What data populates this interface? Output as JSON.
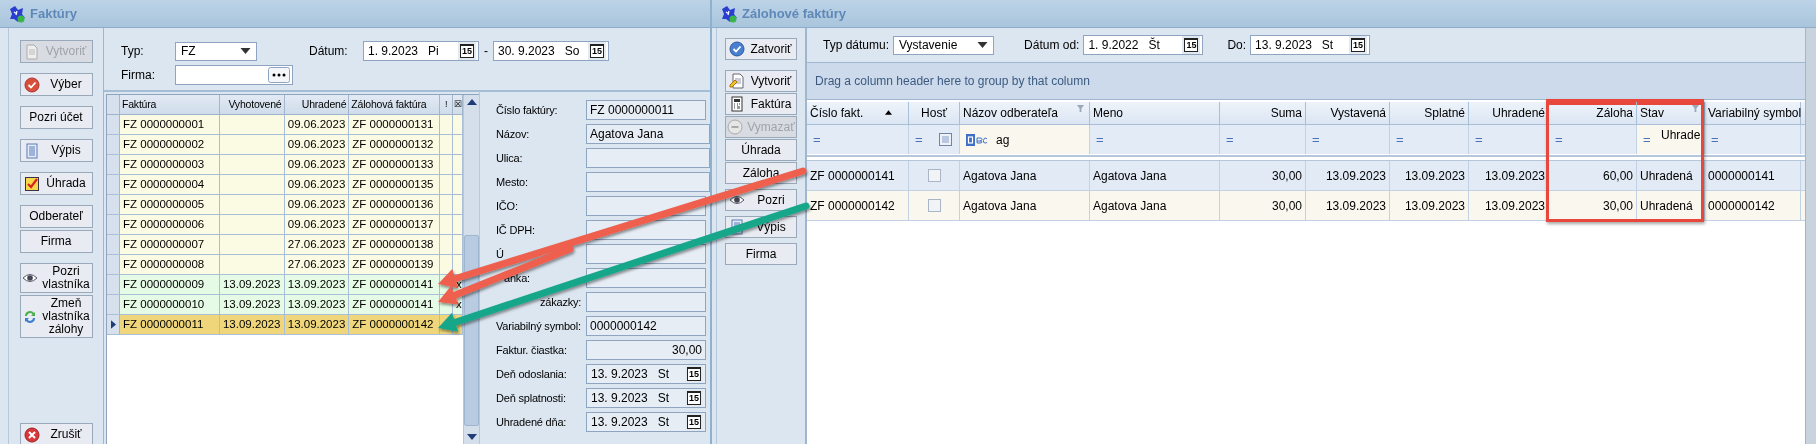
{
  "left_window": {
    "title": "Faktúry",
    "toolbar": [
      {
        "label": "Vytvoriť",
        "disabled": true
      },
      {
        "label": "Výber",
        "disabled": false
      },
      {
        "label": "Pozri účet",
        "disabled": false
      },
      {
        "label": "Výpis",
        "disabled": false
      },
      {
        "label": "Úhrada",
        "disabled": false
      },
      {
        "label": "Odberateľ",
        "disabled": false
      },
      {
        "label": "Firma",
        "disabled": false
      },
      {
        "label": "Pozri vlastníka",
        "disabled": false
      },
      {
        "label": "Zmeň vlastníka zálohy",
        "disabled": false
      },
      {
        "label": "Zrušiť",
        "disabled": false
      }
    ],
    "filters": {
      "type_label": "Typ:",
      "type_value": "FZ",
      "date_label": "Dátum:",
      "date_from": {
        "value": "1. 9.2023   Pi",
        "button": "15"
      },
      "date_separator": "-",
      "date_to": {
        "value": "30. 9.2023   So",
        "button": "15"
      },
      "firma_label": "Firma:"
    },
    "grid": {
      "columns": [
        "Faktúra",
        "Vyhotovené",
        "Uhradené",
        "Zálohová faktúra",
        "!",
        "☒"
      ],
      "rows": [
        {
          "faktura": "FZ 0000000001",
          "uhradene": "09.06.2023",
          "zalohova": "ZF 0000000131",
          "color": "#fbfbe3",
          "selected": false
        },
        {
          "faktura": "FZ 0000000002",
          "uhradene": "09.06.2023",
          "zalohova": "ZF 0000000132",
          "color": "#fbfbe3",
          "selected": false
        },
        {
          "faktura": "FZ 0000000003",
          "uhradene": "09.06.2023",
          "zalohova": "ZF 0000000133",
          "color": "#fbfbe3",
          "selected": false
        },
        {
          "faktura": "FZ 0000000004",
          "uhradene": "09.06.2023",
          "zalohova": "ZF 0000000135",
          "color": "#fbfbe3",
          "selected": false
        },
        {
          "faktura": "FZ 0000000005",
          "uhradene": "09.06.2023",
          "zalohova": "ZF 0000000136",
          "color": "#fbfbe3",
          "selected": false
        },
        {
          "faktura": "FZ 0000000006",
          "uhradene": "09.06.2023",
          "zalohova": "ZF 0000000137",
          "color": "#fbfbe3",
          "selected": false
        },
        {
          "faktura": "FZ 0000000007",
          "uhradene": "27.06.2023",
          "zalohova": "ZF 0000000138",
          "color": "#fbfbe3",
          "selected": false
        },
        {
          "faktura": "FZ 0000000008",
          "uhradene": "27.06.2023",
          "zalohova": "ZF 0000000139",
          "color": "#fbfbe3",
          "selected": false
        },
        {
          "faktura": "FZ 0000000009",
          "vyhotovene": "13.09.2023",
          "uhradene": "13.09.2023",
          "zalohova": "ZF 0000000141",
          "mark": "x",
          "color": "#e6fbe6",
          "selected": false
        },
        {
          "faktura": "FZ 0000000010",
          "vyhotovene": "13.09.2023",
          "uhradene": "13.09.2023",
          "zalohova": "ZF 0000000141",
          "mark": "x",
          "color": "#e6fbe6",
          "selected": false
        },
        {
          "faktura": "FZ 0000000011",
          "vyhotovene": "13.09.2023",
          "uhradene": "13.09.2023",
          "zalohova": "ZF 0000000142",
          "color": "#f0d67a",
          "selected": true
        }
      ]
    },
    "detail": [
      {
        "label": "Číslo faktúry:",
        "value": "FZ 0000000011",
        "kind": "text"
      },
      {
        "label": "Názov:",
        "value": "Agatova Jana",
        "kind": "text"
      },
      {
        "label": "Ulica:",
        "kind": "text"
      },
      {
        "label": "Mesto:",
        "kind": "text"
      },
      {
        "label": "IČO:",
        "kind": "text"
      },
      {
        "label": "IČ DPH:",
        "kind": "text"
      },
      {
        "label": "Ú",
        "kind": "text"
      },
      {
        "label": "anka:",
        "kind": "text"
      },
      {
        "label": "zákazky:",
        "kind": "text"
      },
      {
        "label": "Variabilný symbol:",
        "value": "0000000142",
        "kind": "text"
      },
      {
        "label": "Faktur. čiastka:",
        "value": "30,00",
        "kind": "amount"
      },
      {
        "label": "Deň odoslania:",
        "value": "13. 9.2023   St",
        "button": "15",
        "kind": "date"
      },
      {
        "label": "Deň splatnosti:",
        "value": "13. 9.2023   St",
        "button": "15",
        "kind": "date"
      },
      {
        "label": "Uhradené dňa:",
        "value": "13. 9.2023   St",
        "button": "15",
        "kind": "date"
      }
    ]
  },
  "right_window": {
    "title": "Zálohové faktúry",
    "toolbar": [
      {
        "label": "Zatvoriť",
        "disabled": false
      },
      {
        "label": "Vytvoriť",
        "disabled": false
      },
      {
        "label": "Faktúra",
        "disabled": false
      },
      {
        "label": "Vymazať",
        "disabled": true
      },
      {
        "label": "Úhrada",
        "disabled": false
      },
      {
        "label": "Záloha",
        "disabled": false
      },
      {
        "label": "Pozri",
        "disabled": false
      },
      {
        "label": "Výpis",
        "disabled": false
      },
      {
        "label": "Firma",
        "disabled": false
      }
    ],
    "filters": {
      "type_label": "Typ dátumu:",
      "type_value": "Vystavenie",
      "from_label": "Dátum od:",
      "from": {
        "value": "1. 9.2022   Št",
        "button": "15"
      },
      "to_label": "Do:",
      "to": {
        "value": "13. 9.2023   St",
        "button": "15"
      }
    },
    "group_hint": "Drag a column header here to group by that column",
    "columns": [
      {
        "name": "Číslo fakt.",
        "kind": "text",
        "sorted": true,
        "filtered": false,
        "highlighted": false,
        "operator": "="
      },
      {
        "name": "Hosť",
        "kind": "check",
        "sorted": false,
        "filtered": false,
        "highlighted": false,
        "operator": "=",
        "filter_indeterminate": true
      },
      {
        "name": "Názov odberateľa",
        "kind": "text",
        "sorted": false,
        "filtered": true,
        "highlighted": false,
        "filter_value": "ag"
      },
      {
        "name": "Meno",
        "kind": "text",
        "sorted": false,
        "filtered": false,
        "highlighted": false,
        "operator": "="
      },
      {
        "name": "Suma",
        "kind": "text",
        "sorted": false,
        "filtered": false,
        "highlighted": false,
        "operator": "="
      },
      {
        "name": "Vystavená",
        "kind": "text",
        "sorted": false,
        "filtered": false,
        "highlighted": false,
        "operator": "="
      },
      {
        "name": "Splatné",
        "kind": "text",
        "sorted": false,
        "filtered": false,
        "highlighted": false,
        "operator": "="
      },
      {
        "name": "Uhradené",
        "kind": "text",
        "sorted": false,
        "filtered": false,
        "highlighted": false,
        "operator": "="
      },
      {
        "name": "Záloha",
        "kind": "text",
        "sorted": false,
        "filtered": false,
        "highlighted": true,
        "operator": "="
      },
      {
        "name": "Stav",
        "kind": "text",
        "sorted": false,
        "filtered": true,
        "highlighted": true,
        "operator": "=",
        "filter_value": "Uhrade"
      },
      {
        "name": "Variabilný symbol",
        "kind": "text",
        "sorted": false,
        "filtered": false,
        "highlighted": false,
        "operator": "="
      }
    ],
    "rows": [
      {
        "selected": true,
        "host_checked": false,
        "cells": [
          "ZF 0000000141",
          "",
          "Agatova Jana",
          "Agatova Jana",
          "30,00",
          "13.09.2023",
          "13.09.2023",
          "13.09.2023",
          "60,00",
          "Uhradená",
          "0000000141"
        ]
      },
      {
        "selected": false,
        "host_checked": false,
        "cells": [
          "ZF 0000000142",
          "",
          "Agatova Jana",
          "Agatova Jana",
          "30,00",
          "13.09.2023",
          "13.09.2023",
          "13.09.2023",
          "30,00",
          "Uhradená",
          "0000000142"
        ]
      }
    ]
  }
}
